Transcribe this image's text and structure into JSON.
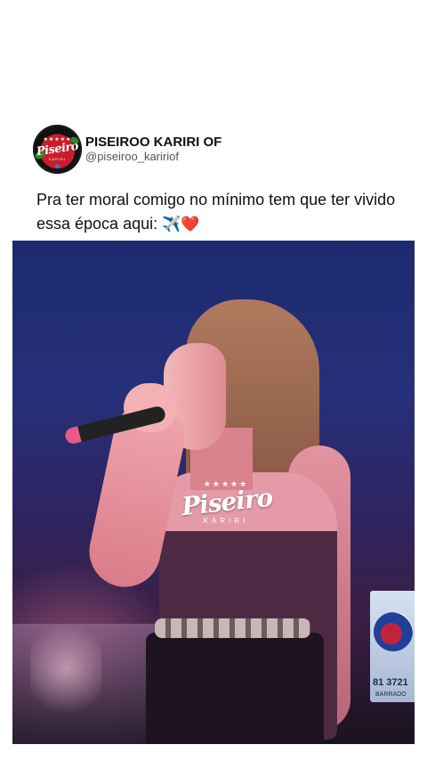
{
  "post": {
    "display_name": "PISEIROO KARIRI OF",
    "handle": "@piseiroo_kaririof",
    "avatar": {
      "logo_text": "Piseiro",
      "logo_sub": "KARIRI",
      "stars": "★★★★★"
    },
    "caption": "Pra ter moral comigo no mínimo tem que ter vivido essa época aqui: ",
    "caption_emojis": "✈️❤️"
  },
  "video": {
    "watermark": {
      "stars": "★★★★★",
      "text": "Piseiro",
      "sub": "KARIRI"
    },
    "tv_bug": {
      "number": "81 3721",
      "sub": "BARRADO"
    }
  },
  "colors": {
    "background": "#ffffff",
    "text_primary": "#111111",
    "text_secondary": "#555555",
    "stage_blue": "#26307a",
    "avatar_red": "#c91c2a"
  }
}
